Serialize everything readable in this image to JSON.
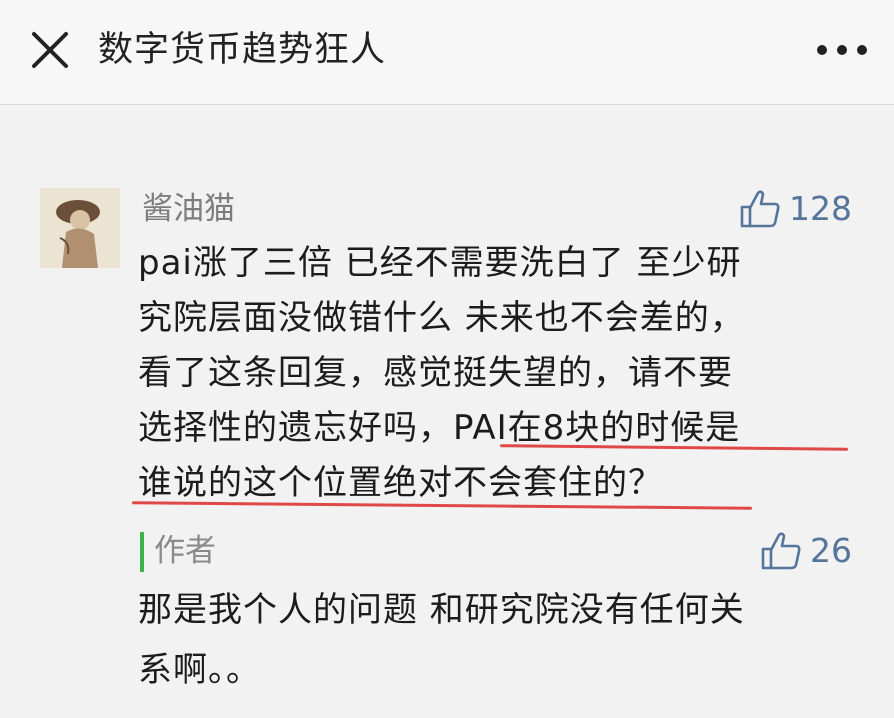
{
  "header": {
    "title": "数字货币趋势狂人",
    "close_icon": "close-icon",
    "more_icon": "more-dots-icon"
  },
  "comment": {
    "nickname": "酱油猫",
    "likes": "128",
    "lines": [
      "pai涨了三倍  已经不需要洗白了 至少研",
      "究院层面没做错什么 未来也不会差的，",
      "看了这条回复，感觉挺失望的，请不要",
      "选择性的遗忘好吗，PAI在8块的时候是",
      "谁说的这个位置绝对不会套住的？"
    ],
    "colors": {
      "underline": "#e04848",
      "like": "#55759b"
    }
  },
  "reply": {
    "label": "作者",
    "likes": "26",
    "lines": [
      "那是我个人的问题 和研究院没有任何关",
      "系啊。。"
    ],
    "colors": {
      "bar": "#3cb34a"
    }
  }
}
